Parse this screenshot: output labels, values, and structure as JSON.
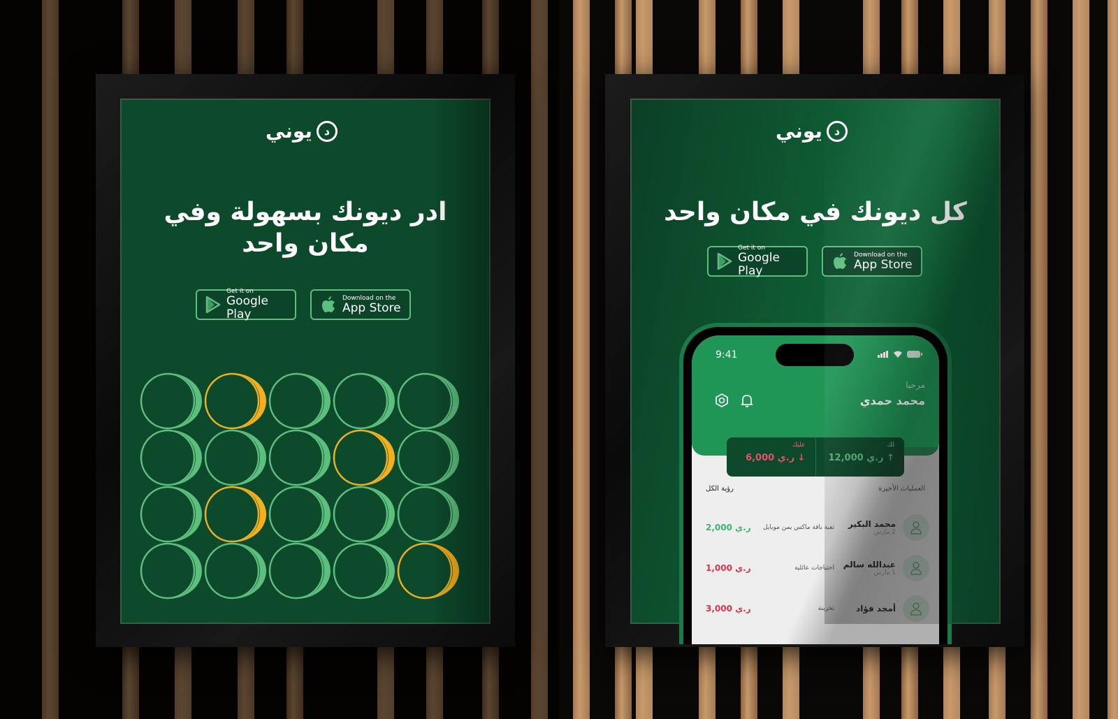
{
  "brand": {
    "logo_text": "يوني",
    "logo_letter": "د",
    "colors": {
      "poster_green": "#0d4a2b",
      "accent_green": "#5dbf7e",
      "accent_yellow": "#f2b01e",
      "screen_green": "#1f9556",
      "credit_color": "#3fb56a",
      "debit_color": "#d8344a"
    }
  },
  "poster_left": {
    "headline_line1": "ادر ديونك بسهولة وفي",
    "headline_line2": "مكان واحد",
    "google_play": {
      "small": "Get it on",
      "big": "Google Play",
      "icon": "google-play-icon"
    },
    "app_store": {
      "small": "Download on the",
      "big": "App Store",
      "icon": "apple-icon"
    },
    "ring_grid": {
      "rows": 4,
      "cols": 5,
      "highlighted": [
        [
          0,
          1
        ],
        [
          1,
          3
        ],
        [
          2,
          1
        ],
        [
          3,
          4
        ]
      ]
    }
  },
  "poster_right": {
    "headline": "كل ديونك في مكان واحد",
    "google_play": {
      "small": "Get it on",
      "big": "Google Play",
      "icon": "google-play-icon"
    },
    "app_store": {
      "small": "Download on the",
      "big": "App Store",
      "icon": "apple-icon"
    }
  },
  "phone": {
    "status_time": "9:41",
    "greeting": "مرحبا",
    "user_name": "محمد حمدي",
    "icons": [
      "settings-icon",
      "bell-icon"
    ],
    "balance": {
      "owed_to_you_label": "لك",
      "owed_to_you_amount": "12,000 ر.ي",
      "owed_to_you_arrow": "↑",
      "you_owe_label": "عليك",
      "you_owe_amount": "6,000 ر.ي",
      "you_owe_arrow": "↓"
    },
    "recent_label": "العمليات الأخيرة",
    "see_all_label": "رؤية الكل",
    "transactions": [
      {
        "name": "محمد البكير",
        "date": "2 مارس",
        "description": "تعبة باقة ماكس يمن موبايل",
        "amount": "2,000 ر.ي",
        "type": "credit"
      },
      {
        "name": "عبدالله سالم",
        "date": "1 مارس",
        "description": "احتياجات عائلية",
        "amount": "1,000 ر.ي",
        "type": "debit"
      },
      {
        "name": "أمجد فؤاد",
        "date": "",
        "description": "تخزينة",
        "amount": "3,000 ر.ي",
        "type": "debit"
      }
    ]
  }
}
